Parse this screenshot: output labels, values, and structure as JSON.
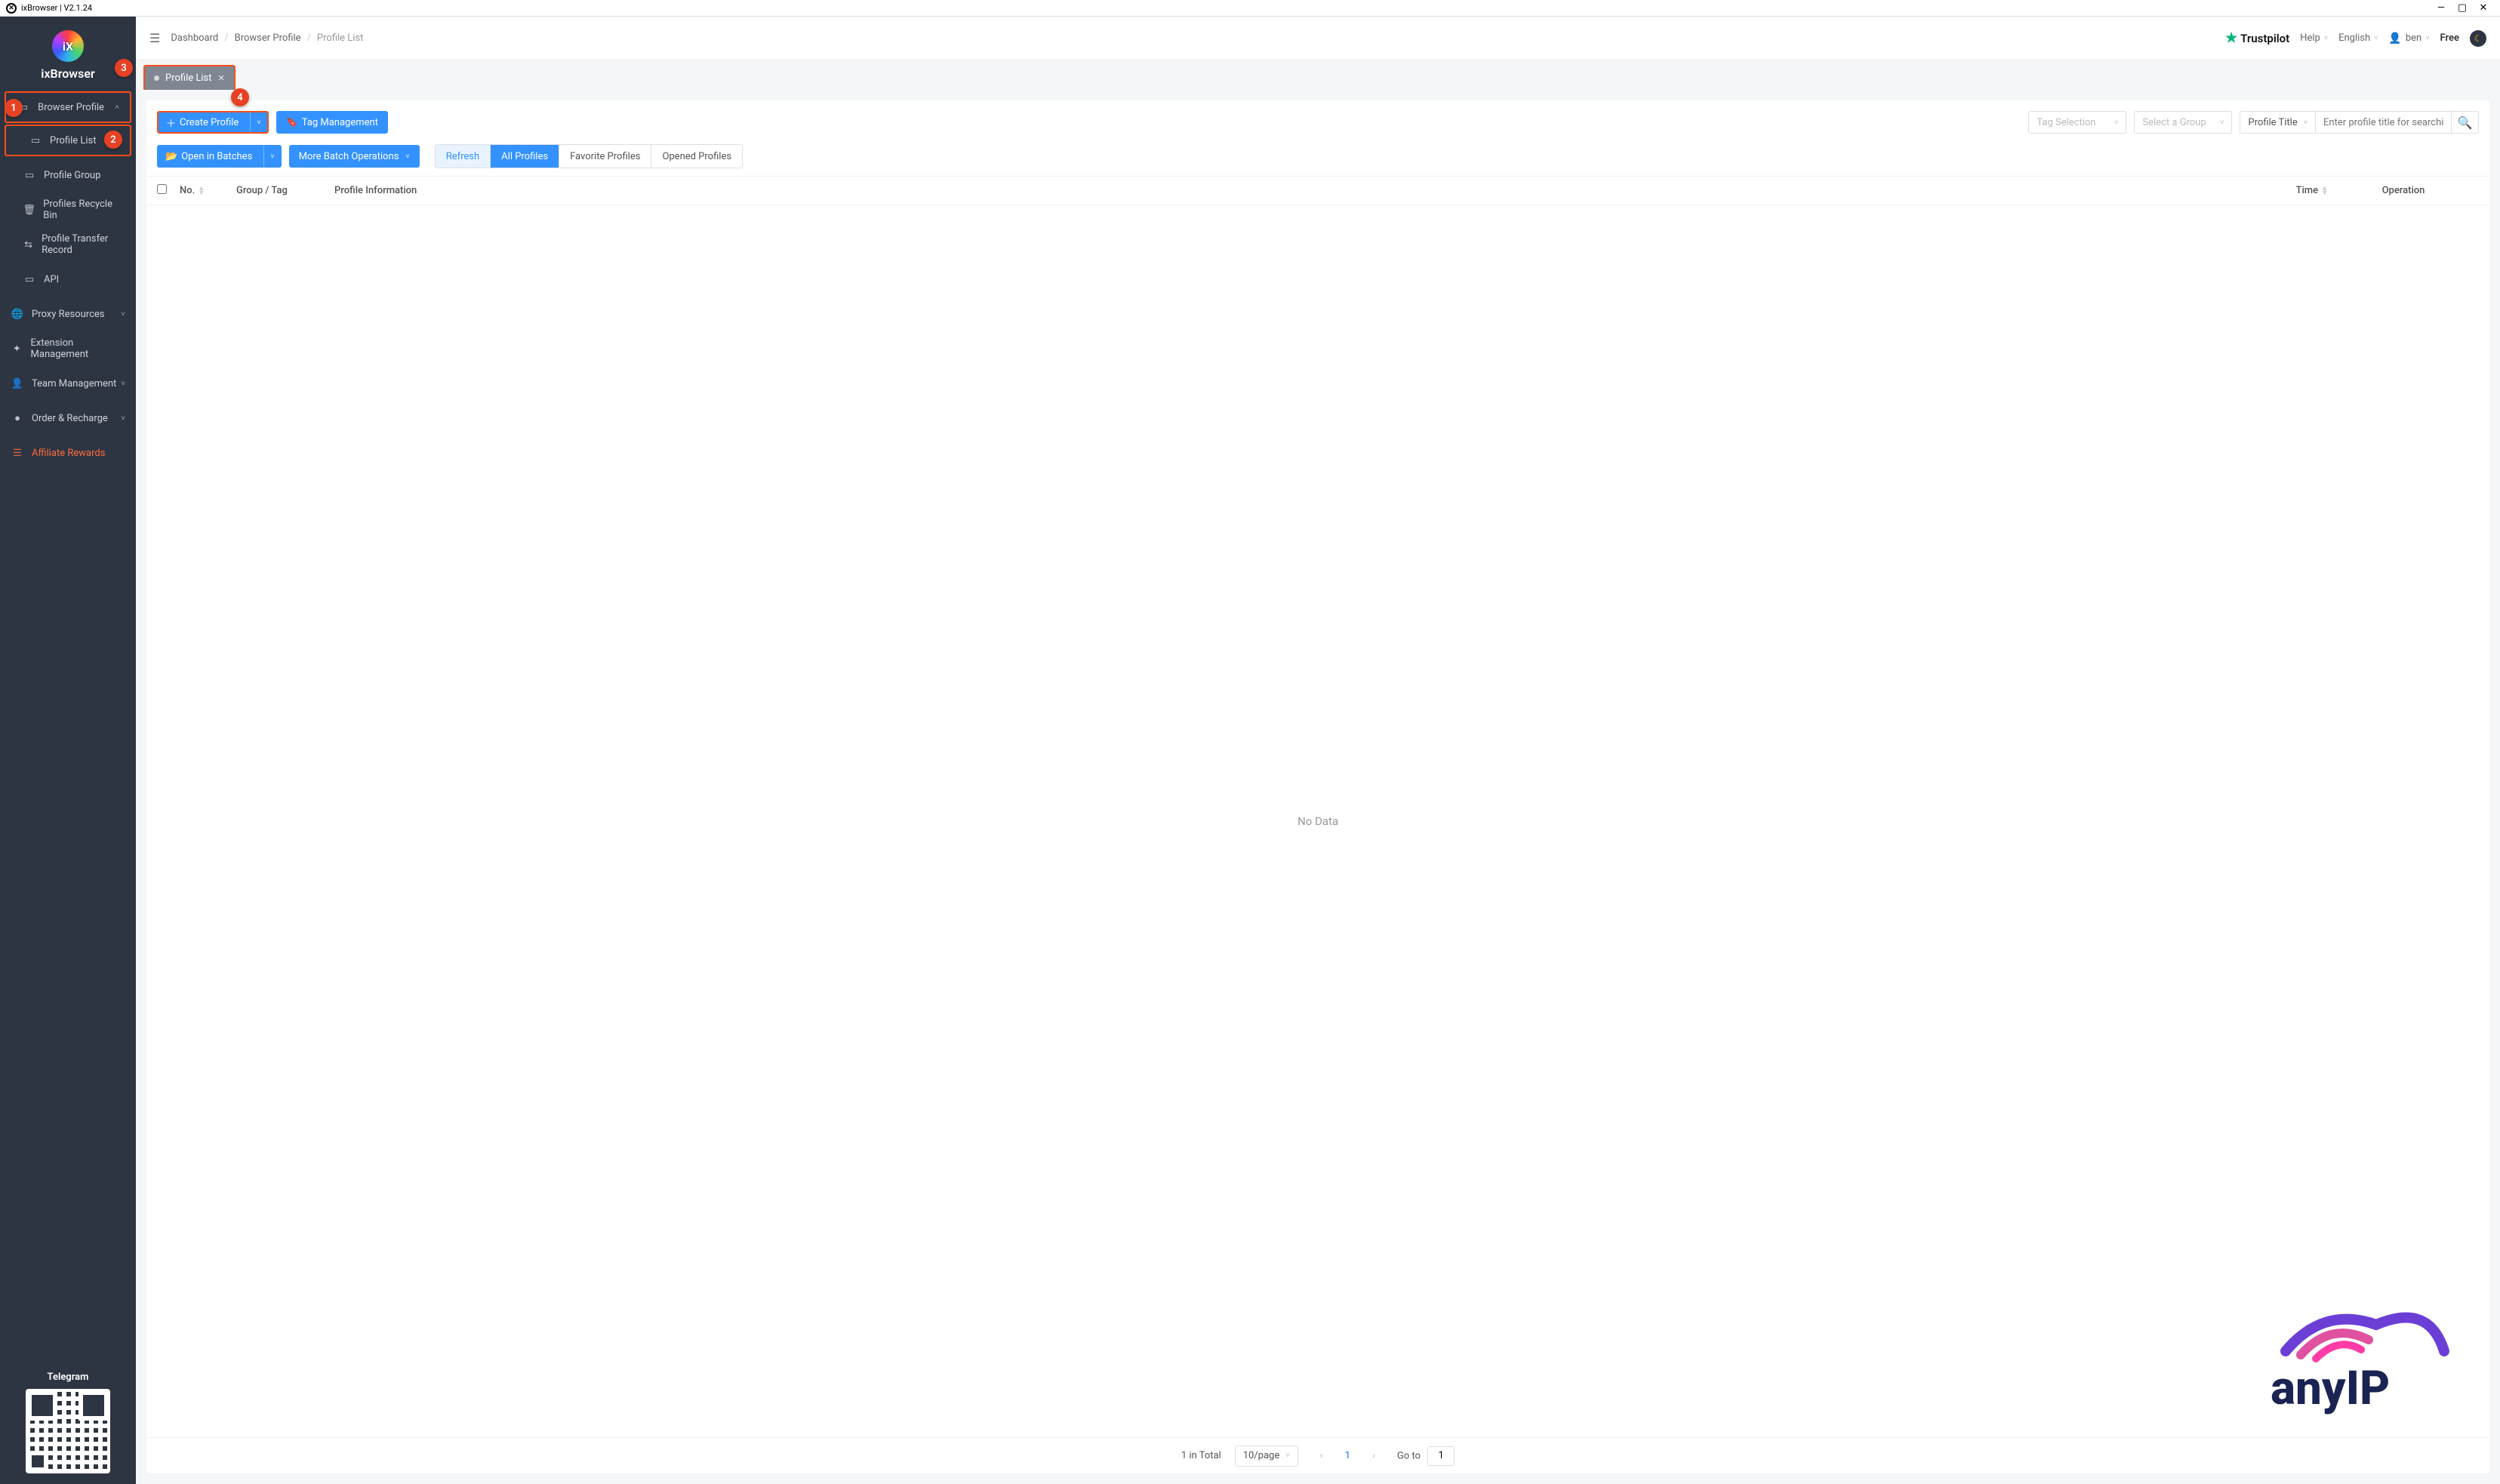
{
  "titlebar": {
    "title": "ixBrowser | V2.1.24"
  },
  "brand": {
    "name": "ixBrowser"
  },
  "sidebar": {
    "items": [
      {
        "label": "Browser Profile",
        "icon": "▭",
        "expandable": true
      },
      {
        "label": "Profile List",
        "icon": "▭"
      },
      {
        "label": "Profile Group",
        "icon": "▭"
      },
      {
        "label": "Profiles Recycle Bin",
        "icon": "🗑"
      },
      {
        "label": "Profile Transfer Record",
        "icon": "⇆"
      },
      {
        "label": "API",
        "icon": "▭"
      },
      {
        "label": "Proxy Resources",
        "icon": "🌐",
        "expandable": true
      },
      {
        "label": "Extension Management",
        "icon": "✦"
      },
      {
        "label": "Team Management",
        "icon": "👤",
        "expandable": true
      },
      {
        "label": "Order & Recharge",
        "icon": "●",
        "expandable": true
      },
      {
        "label": "Affiliate Rewards",
        "icon": "☰"
      }
    ],
    "telegram": "Telegram"
  },
  "callouts": {
    "one": "1",
    "two": "2",
    "three": "3",
    "four": "4"
  },
  "breadcrumb": {
    "dashboard": "Dashboard",
    "browser_profile": "Browser Profile",
    "profile_list": "Profile List"
  },
  "topbar": {
    "trustpilot": "Trustpilot",
    "help": "Help",
    "language": "English",
    "user": "ben",
    "plan": "Free"
  },
  "tabs": {
    "profile_list": "Profile List"
  },
  "toolbar": {
    "create_profile": "Create Profile",
    "tag_management": "Tag Management",
    "tag_selection": "Tag Selection",
    "select_group": "Select a Group",
    "search_filter": "Profile Title",
    "search_placeholder": "Enter profile title for searching",
    "open_batches": "Open in Batches",
    "more_batch": "More Batch Operations",
    "refresh": "Refresh",
    "all_profiles": "All Profiles",
    "favorite": "Favorite Profiles",
    "opened": "Opened Profiles"
  },
  "table": {
    "no": "No.",
    "group_tag": "Group / Tag",
    "profile_info": "Profile Information",
    "time": "Time",
    "operation": "Operation",
    "empty": "No Data"
  },
  "pager": {
    "total": "1 in Total",
    "per_page": "10/page",
    "current": "1",
    "goto": "Go to",
    "goto_val": "1"
  },
  "watermark": {
    "text": "anyIP"
  }
}
